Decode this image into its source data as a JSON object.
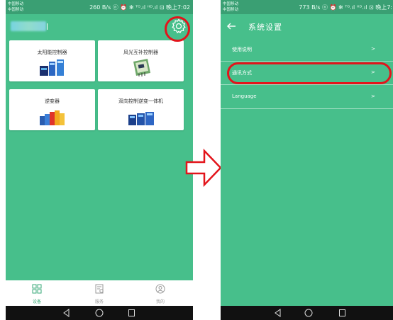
{
  "left_screen": {
    "status_bar": {
      "carrier_line1": "中国移动",
      "carrier_line2": "中国移动",
      "info": "260 B/s ⓝ ⏰ ✻ ᵀᴳ.ıl ᴴᴰ.ıl ⊡ 晚上7:02"
    },
    "header": {
      "settings_icon": "gear-icon"
    },
    "devices": [
      {
        "label": "太阳能控制器"
      },
      {
        "label": "风光互补控制器"
      },
      {
        "label": "逆变器"
      },
      {
        "label": "双向控制逆变一体机"
      }
    ],
    "bottom_nav": [
      {
        "label": "设备",
        "icon": "grid-icon",
        "active": true
      },
      {
        "label": "服务",
        "icon": "service-icon",
        "active": false
      },
      {
        "label": "我的",
        "icon": "user-icon",
        "active": false
      }
    ]
  },
  "right_screen": {
    "status_bar": {
      "carrier_line1": "中国移动",
      "carrier_line2": "中国移动",
      "info": "773 B/s ⓝ ⏰ ✻ ᵀᴳ.ıl ᴴᴰ.ıl ⊡ 晚上7:"
    },
    "header": {
      "back_icon": "back-arrow-icon",
      "title": "系统设置"
    },
    "settings": [
      {
        "label": "使用说明",
        "chevron": ">"
      },
      {
        "label": "通讯方式",
        "chevron": ">"
      },
      {
        "label": "Language",
        "chevron": ">"
      }
    ]
  },
  "colors": {
    "app_green": "#47bf8b",
    "status_green": "#3a9f73",
    "highlight_red": "#e3141b"
  }
}
